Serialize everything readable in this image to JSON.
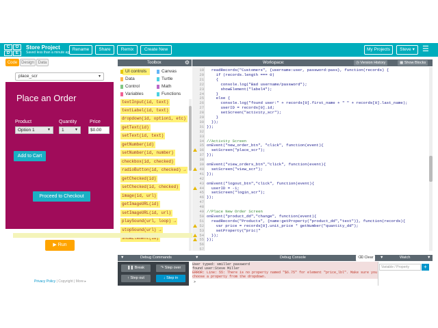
{
  "header": {
    "logo_letters": [
      "C",
      "O",
      "D",
      "E"
    ],
    "project_title": "Store Project",
    "saved_text": "Saved less than a minute ago",
    "buttons": [
      "Rename",
      "Share",
      "Remix",
      "Create New"
    ],
    "my_projects": "My Projects",
    "user": "Steve",
    "user_caret": "▾",
    "brand_color": "#00adbc"
  },
  "left": {
    "tabs": [
      "Code",
      "Design",
      "Data"
    ],
    "screen_select": "place_scr",
    "select_caret": "▾",
    "app": {
      "bg_color": "#a00c5a",
      "title": "Place an Order",
      "product_label": "Product",
      "quantity_label": "Quantity",
      "price_label": "Price",
      "product_value": "Option 1",
      "quantity_value": "1",
      "price_value": "$0.00",
      "add_to_cart": "Add to Cart",
      "checkout": "Proceed to Checkout"
    },
    "run_label": "▶ Run",
    "footer": [
      "Privacy Policy",
      "Copyright",
      "More ▸"
    ],
    "footer_sep": "|"
  },
  "toolbox": {
    "title": "Toolbox",
    "gear_icon": "gear-icon",
    "categories": [
      {
        "label": "UI controls",
        "color": "#fff176"
      },
      {
        "label": "Canvas",
        "color": "#64b5f6"
      },
      {
        "label": "Data",
        "color": "#ffb74d"
      },
      {
        "label": "Turtle",
        "color": "#4dd0e1"
      },
      {
        "label": "Control",
        "color": "#81c784"
      },
      {
        "label": "Math",
        "color": "#ba68c8"
      },
      {
        "label": "Variables",
        "color": "#f06292"
      },
      {
        "label": "Functions",
        "color": "#4dd0e1"
      }
    ],
    "blocks": [
      "textInput(id, text)",
      "textLabel(id, text)",
      "dropdown(id, option1, etc)",
      "getText(id)",
      "setText(id, text)",
      "getNumber(id)",
      "setNumber(id, number)",
      "checkbox(id, checked)",
      "radioButton(id, checked) →",
      "getChecked(id)",
      "setChecked(id, checked)",
      "image(id, url)",
      "getImageURL(id)",
      "setImageURL(id, url)",
      "playSound(url, loop) →",
      "stopSound(url) →",
      "showElement(id)"
    ]
  },
  "workspace": {
    "title": "Workspace:",
    "version_history": "Version History",
    "show_blocks": "Show Blocks",
    "line_numbers": [
      "19",
      "20",
      "21",
      "22",
      "23",
      "24",
      "25",
      "26",
      "27",
      "28",
      "29",
      "30",
      "31",
      "32",
      "33",
      "34",
      "35",
      "36",
      "37",
      "38",
      "39",
      "40",
      "41",
      "42",
      "43",
      "44",
      "45",
      "46",
      "47",
      "48",
      "49",
      "50",
      "51",
      "52",
      "53",
      "54",
      "55",
      "56",
      "57"
    ],
    "warn_lines": [
      36,
      40,
      44,
      52,
      54,
      55
    ],
    "lines": [
      "  readRecords(\"Customers\", {username:user, password:pass}, function(records) {",
      "    if (records.length === 0)",
      "    {",
      "      console.log(\"Bad username/password\");",
      "      showElement(\"label4\");",
      "    }",
      "    else {",
      "      console.log(\"found user:\" + records[0].first_name + \" \" + records[0].last_name);",
      "      userID = records[0].id;",
      "      setScreen(\"activity_scr\");",
      "    }",
      "  });",
      "});",
      "",
      "",
      "//Activity Screen",
      "onEvent(\"new_order_btn\", \"click\", function(event){",
      "  setScreen(\"place_scr\");",
      "});",
      "",
      "onEvent(\"view_orders_btn\",\"click\", function(event){",
      "  setScreen(\"view_scr\");",
      "});",
      "",
      "onEvent(\"logout_btn\",\"click\", function(event){",
      "  userID = -1;",
      "  setScreen(\"login_scr\");",
      "});",
      "",
      "",
      "//Place New Order Screen",
      "onEvent(\"product_dd\",\"change\", function(event){",
      "  readRecords(\"Products\", {name:getProperty(\"product_dd\",\"text\")}, function(records){",
      "    var price = records[0].unit_price * getNumber(\"quantity_dd\");",
      "    setProperty(\"pric|\"",
      "  });",
      "});",
      "",
      ""
    ]
  },
  "debug": {
    "commands_title": "Debug Commands",
    "console_title": "Debug Console",
    "clear": "Clear",
    "watch_title": "Watch",
    "buttons": [
      "Break",
      "Step over",
      "Step out",
      "Step in"
    ],
    "console_lines": [
      "User typed: smiller password",
      "found user:Steve Miller",
      "ERROR: Line: 55: There is no property named \"$6.75\" for element \"price_lbl\". Make sure you",
      "choose a property from the dropdown."
    ],
    "prompt": ">",
    "watch_placeholder": "Variable / Property",
    "watch_add": "+"
  }
}
